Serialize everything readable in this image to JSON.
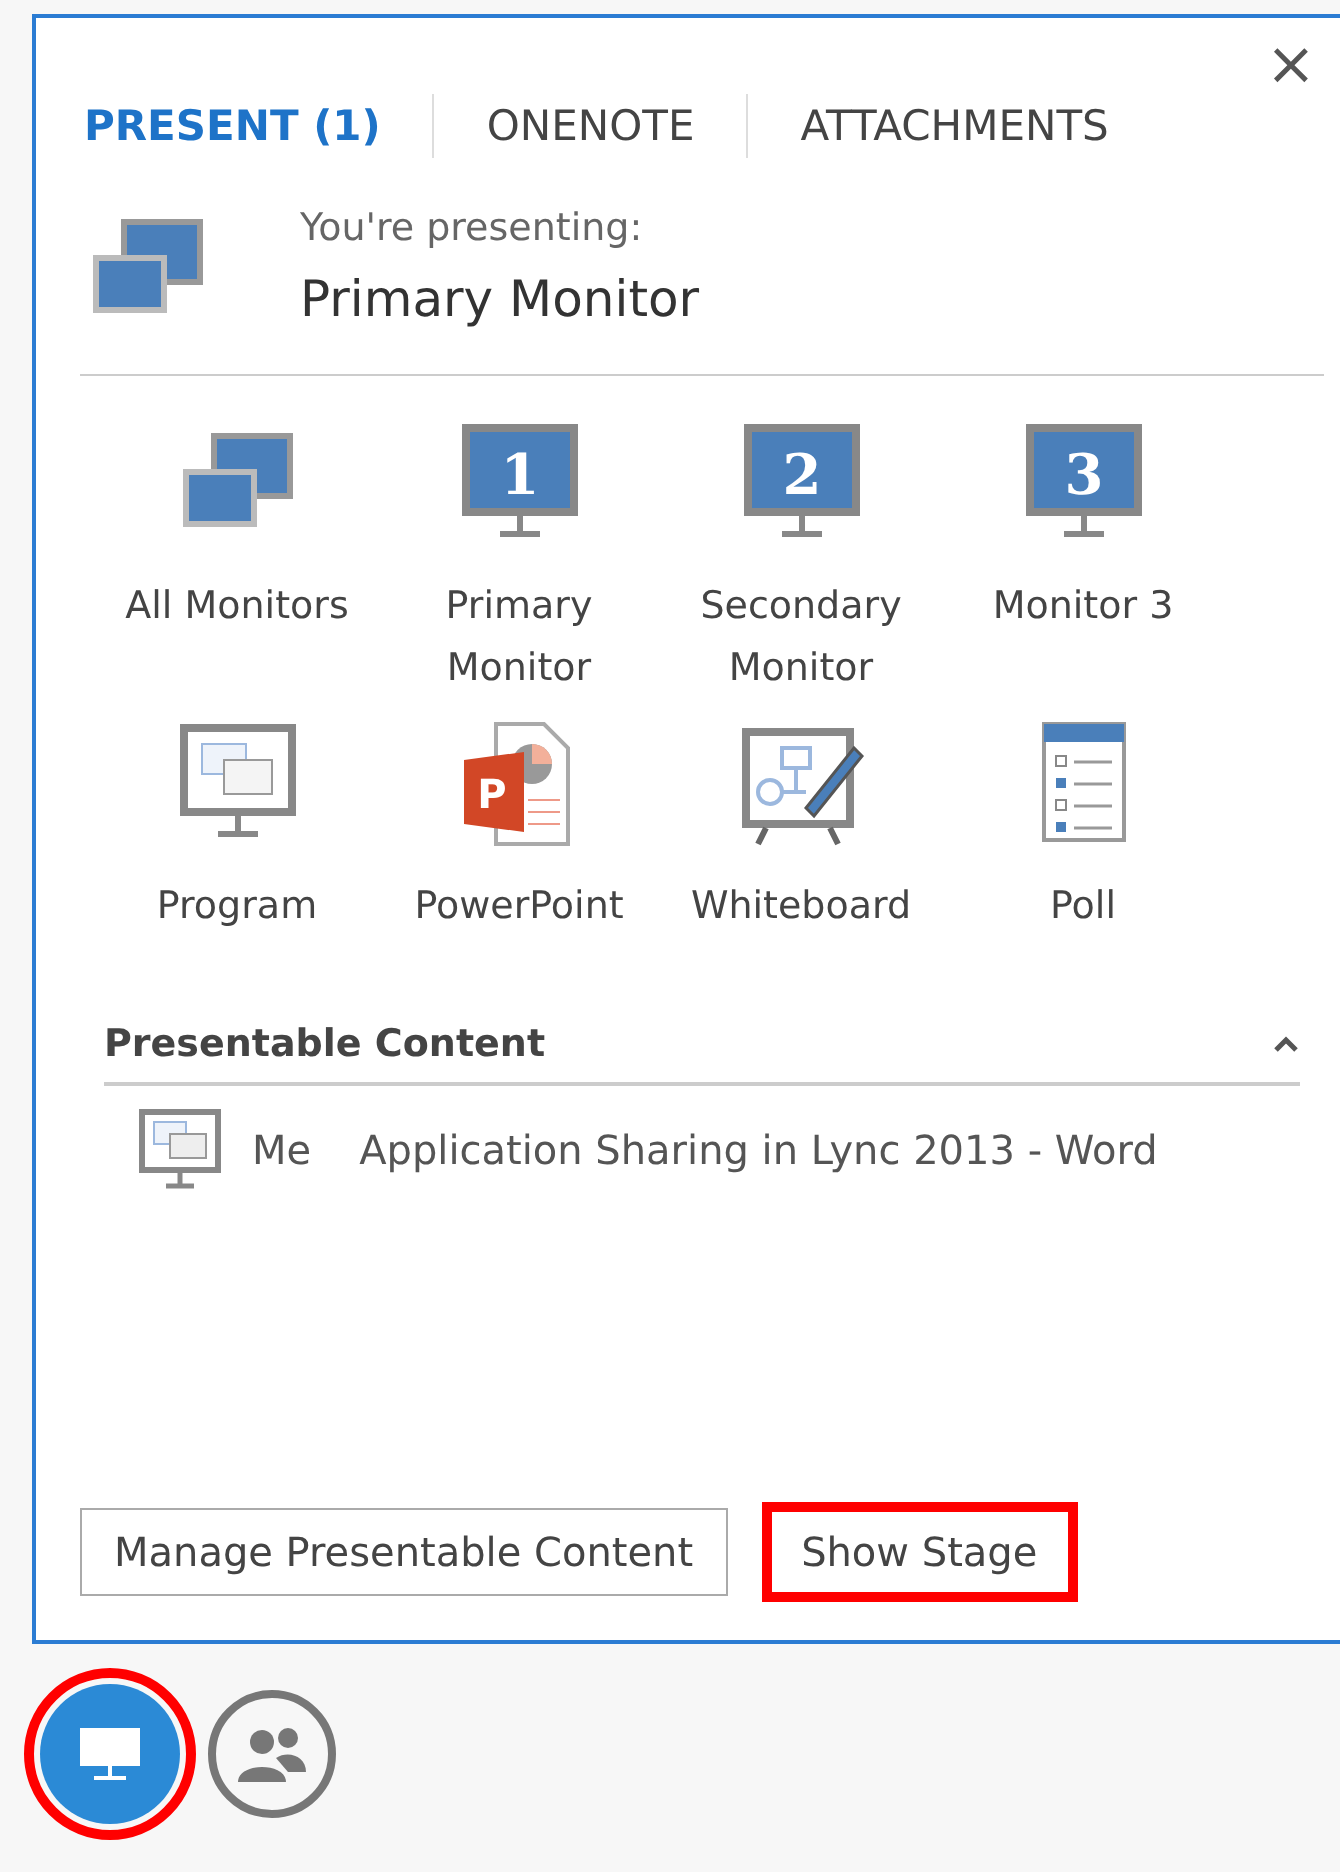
{
  "close": "×",
  "tabs": [
    {
      "label": "PRESENT (1)",
      "selected": true
    },
    {
      "label": "ONENOTE",
      "selected": false
    },
    {
      "label": "ATTACHMENTS",
      "selected": false
    }
  ],
  "presenting": {
    "caption": "You're presenting:",
    "target": "Primary Monitor"
  },
  "tiles": [
    {
      "kind": "monitors",
      "label": "All Monitors"
    },
    {
      "kind": "monitor",
      "badge": "1",
      "label": "Primary Monitor"
    },
    {
      "kind": "monitor",
      "badge": "2",
      "label": "Secondary Monitor"
    },
    {
      "kind": "monitor",
      "badge": "3",
      "label": "Monitor 3"
    },
    {
      "kind": "program",
      "label": "Program"
    },
    {
      "kind": "powerpoint",
      "badge": "P",
      "label": "PowerPoint"
    },
    {
      "kind": "whiteboard",
      "label": "Whiteboard"
    },
    {
      "kind": "poll",
      "label": "Poll"
    }
  ],
  "section": {
    "title": "Presentable Content",
    "expanded": true,
    "items": [
      {
        "owner": "Me",
        "title": "Application Sharing in Lync 2013 - Word"
      }
    ]
  },
  "buttons": [
    {
      "label": "Manage Presentable Content",
      "highlighted": false
    },
    {
      "label": "Show Stage",
      "highlighted": true
    }
  ],
  "toolbar": [
    {
      "kind": "present",
      "selected": true,
      "highlighted": true
    },
    {
      "kind": "people",
      "selected": false,
      "highlighted": false
    }
  ]
}
